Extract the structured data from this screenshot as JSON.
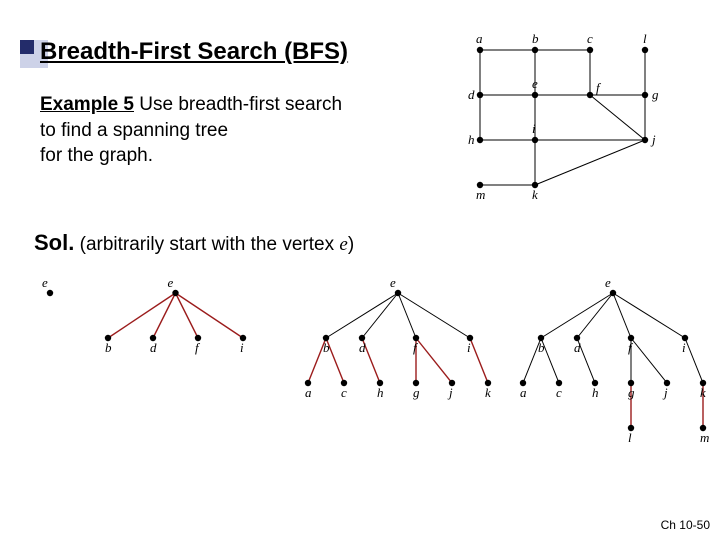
{
  "title": "Breadth-First Search (BFS)",
  "example": {
    "label": "Example 5",
    "text1": " Use breadth-first search",
    "text2": "to find a spanning tree",
    "text3": "for the graph."
  },
  "solution": {
    "label": "Sol.",
    "text": " (arbitrarily start with the vertex ",
    "vertex": "e",
    "close": ")"
  },
  "footer": "Ch 10-50",
  "graph": {
    "vertices": [
      "a",
      "b",
      "c",
      "d",
      "e",
      "f",
      "g",
      "h",
      "i",
      "j",
      "k",
      "l",
      "m"
    ],
    "edges": [
      [
        "a",
        "b"
      ],
      [
        "a",
        "d"
      ],
      [
        "b",
        "c"
      ],
      [
        "b",
        "e"
      ],
      [
        "c",
        "f"
      ],
      [
        "d",
        "e"
      ],
      [
        "d",
        "h"
      ],
      [
        "e",
        "f"
      ],
      [
        "e",
        "i"
      ],
      [
        "f",
        "g"
      ],
      [
        "f",
        "j"
      ],
      [
        "g",
        "l"
      ],
      [
        "g",
        "j"
      ],
      [
        "h",
        "i"
      ],
      [
        "i",
        "j"
      ],
      [
        "i",
        "k"
      ],
      [
        "j",
        "k"
      ],
      [
        "m",
        "k"
      ]
    ],
    "positions": {
      "a": [
        0,
        0
      ],
      "b": [
        1,
        0
      ],
      "c": [
        2,
        0
      ],
      "l": [
        3,
        0
      ],
      "d": [
        0,
        1
      ],
      "e": [
        1,
        1
      ],
      "f": [
        2,
        1
      ],
      "g": [
        3,
        1
      ],
      "h": [
        0,
        2
      ],
      "i": [
        1,
        2
      ],
      "j": [
        3,
        2
      ],
      "m": [
        0,
        3
      ],
      "k": [
        1,
        3
      ]
    }
  },
  "bfs_steps": [
    {
      "nodes": {
        "e": [
          0,
          0
        ]
      },
      "red": [],
      "black": []
    },
    {
      "nodes": {
        "e": [
          1.5,
          0
        ],
        "b": [
          0,
          1
        ],
        "d": [
          1,
          1
        ],
        "f": [
          2,
          1
        ],
        "i": [
          3,
          1
        ]
      },
      "red": [
        [
          "e",
          "b"
        ],
        [
          "e",
          "d"
        ],
        [
          "e",
          "f"
        ],
        [
          "e",
          "i"
        ]
      ],
      "black": []
    },
    {
      "nodes": {
        "e": [
          2.5,
          0
        ],
        "b": [
          0.5,
          1
        ],
        "d": [
          1.5,
          1
        ],
        "f": [
          3,
          1
        ],
        "i": [
          4.5,
          1
        ],
        "a": [
          0,
          2
        ],
        "c": [
          1,
          2
        ],
        "h": [
          2,
          2
        ],
        "g": [
          3,
          2
        ],
        "j": [
          4,
          2
        ],
        "k": [
          5,
          2
        ]
      },
      "red": [
        [
          "b",
          "a"
        ],
        [
          "b",
          "c"
        ],
        [
          "d",
          "h"
        ],
        [
          "f",
          "g"
        ],
        [
          "f",
          "j"
        ],
        [
          "i",
          "k"
        ]
      ],
      "black": [
        [
          "e",
          "b"
        ],
        [
          "e",
          "d"
        ],
        [
          "e",
          "f"
        ],
        [
          "e",
          "i"
        ]
      ]
    },
    {
      "nodes": {
        "e": [
          2.5,
          0
        ],
        "b": [
          0.5,
          1
        ],
        "d": [
          1.5,
          1
        ],
        "f": [
          3,
          1
        ],
        "i": [
          4.5,
          1
        ],
        "a": [
          0,
          2
        ],
        "c": [
          1,
          2
        ],
        "h": [
          2,
          2
        ],
        "g": [
          3,
          2
        ],
        "j": [
          4,
          2
        ],
        "k": [
          5,
          2
        ],
        "l": [
          3,
          3
        ],
        "m": [
          5,
          3
        ]
      },
      "red": [
        [
          "g",
          "l"
        ],
        [
          "k",
          "m"
        ]
      ],
      "black": [
        [
          "e",
          "b"
        ],
        [
          "e",
          "d"
        ],
        [
          "e",
          "f"
        ],
        [
          "e",
          "i"
        ],
        [
          "b",
          "a"
        ],
        [
          "b",
          "c"
        ],
        [
          "d",
          "h"
        ],
        [
          "f",
          "g"
        ],
        [
          "f",
          "j"
        ],
        [
          "i",
          "k"
        ]
      ]
    }
  ]
}
